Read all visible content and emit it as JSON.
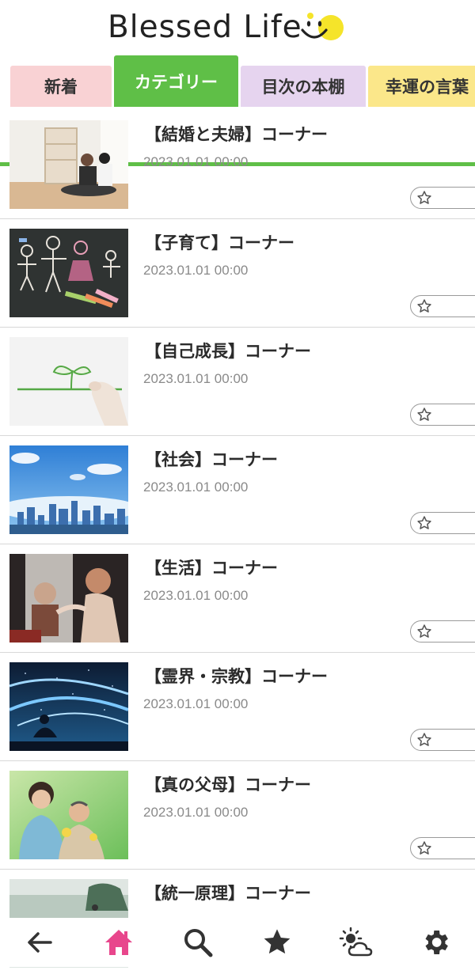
{
  "app": {
    "logo_text": "Blessed Life"
  },
  "tabs": [
    {
      "label": "新着",
      "color": "#f9d2d4",
      "active": false
    },
    {
      "label": "カテゴリー",
      "color": "#5fbf47",
      "active": true
    },
    {
      "label": "目次の本棚",
      "color": "#e6d4ef",
      "active": false
    },
    {
      "label": "幸運の言葉",
      "color": "#fbe78a",
      "active": false
    }
  ],
  "items": [
    {
      "title": "【結婚と夫婦】コーナー",
      "date": "2023.01.01 00:00",
      "thumb": "family-room"
    },
    {
      "title": "【子育て】コーナー",
      "date": "2023.01.01 00:00",
      "thumb": "chalk-drawing"
    },
    {
      "title": "【自己成長】コーナー",
      "date": "2023.01.01 00:00",
      "thumb": "sprout-drawing"
    },
    {
      "title": "【社会】コーナー",
      "date": "2023.01.01 00:00",
      "thumb": "city-skyline"
    },
    {
      "title": "【生活】コーナー",
      "date": "2023.01.01 00:00",
      "thumb": "people-window"
    },
    {
      "title": "【霊界・宗教】コーナー",
      "date": "2023.01.01 00:00",
      "thumb": "night-sky-light"
    },
    {
      "title": "【真の父母】コーナー",
      "date": "2023.01.01 00:00",
      "thumb": "couple-portrait"
    },
    {
      "title": "【統一原理】コーナー",
      "date": "",
      "thumb": "misty-landscape"
    }
  ],
  "nav": {
    "back": "back-arrow-icon",
    "home": "home-icon",
    "search": "search-icon",
    "favorites": "star-icon",
    "weather": "weather-icon",
    "settings": "gear-icon"
  },
  "colors": {
    "accent_green": "#5fbf47",
    "home_pink": "#e8468c",
    "logo_yellow": "#f5e42a"
  }
}
